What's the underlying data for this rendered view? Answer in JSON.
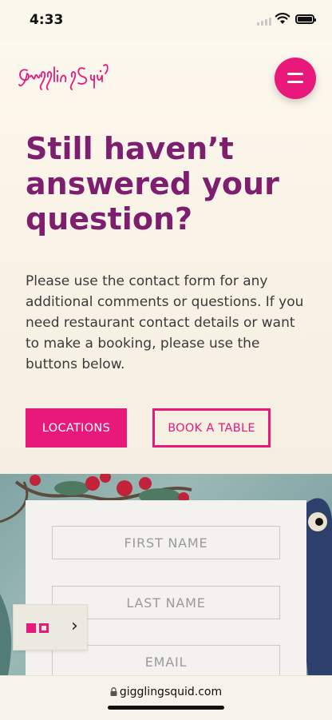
{
  "status": {
    "time": "4:33"
  },
  "header": {
    "logo_text": "GigglingSquid",
    "menu_label": "Menu"
  },
  "hero": {
    "title": "Still haven’t answered your question?",
    "body": "Please use the contact form for any additional comments or questions. If you need restaurant contact details or want to make a booking, please use the buttons below."
  },
  "buttons": {
    "locations": "LOCATIONS",
    "book": "BOOK A TABLE"
  },
  "form": {
    "first_name_placeholder": "FIRST NAME",
    "last_name_placeholder": "LAST NAME",
    "email_placeholder": "EMAIL"
  },
  "side_tab": {
    "arrow": "›"
  },
  "browser": {
    "url": "gigglingsquid.com"
  },
  "colors": {
    "accent": "#e8197a",
    "title": "#7d1f6e",
    "background": "#f7f1e6"
  }
}
